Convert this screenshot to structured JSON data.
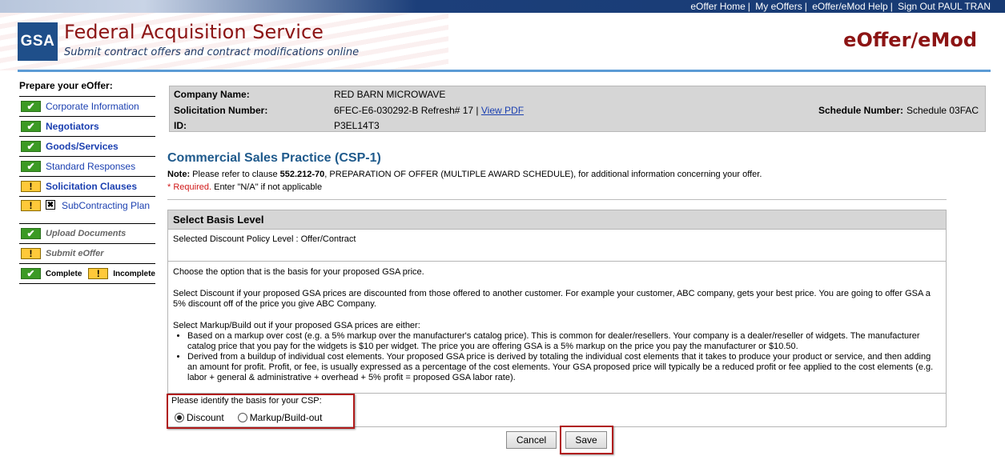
{
  "topbar": {
    "links": [
      "eOffer Home",
      "My eOffers",
      "eOffer/eMod Help",
      "Sign Out PAUL TRAN"
    ]
  },
  "header": {
    "logo_text": "GSA",
    "title": "Federal Acquisition Service",
    "subtitle": "Submit contract offers and contract modifications online",
    "brand": "eOffer/eMod"
  },
  "sidebar": {
    "heading": "Prepare your eOffer:",
    "items": [
      {
        "label": "Corporate Information",
        "status": "complete"
      },
      {
        "label": "Negotiators",
        "status": "complete"
      },
      {
        "label": "Goods/Services",
        "status": "complete"
      },
      {
        "label": "Standard Responses",
        "status": "complete"
      },
      {
        "label": "Solicitation Clauses",
        "status": "incomplete"
      },
      {
        "label": "SubContracting Plan",
        "status": "incomplete"
      },
      {
        "label": "Upload Documents",
        "status": "complete"
      },
      {
        "label": "Submit eOffer",
        "status": "incomplete"
      }
    ],
    "legend_complete": "Complete",
    "legend_incomplete": "Incomplete",
    "check_glyph": "✔",
    "warn_glyph": "!",
    "x_glyph": "✖"
  },
  "company": {
    "name_label": "Company Name:",
    "name_value": "RED BARN MICROWAVE",
    "solicitation_label": "Solicitation Number:",
    "solicitation_value": "6FEC-E6-030292-B Refresh# 17 |",
    "view_pdf": "View PDF",
    "id_label": "ID:",
    "id_value": "P3EL14T3",
    "schedule_label": "Schedule Number:",
    "schedule_value": "Schedule 03FAC"
  },
  "main": {
    "title": "Commercial Sales Practice (CSP-1)",
    "note_prefix": "Note:",
    "note_text_1": " Please refer to clause ",
    "note_clause": "552.212-70",
    "note_text_2": ", PREPARATION OF OFFER (MULTIPLE AWARD SCHEDULE), for additional information concerning your offer.",
    "required": "* Required.",
    "na_text": " Enter \"N/A\" if not applicable",
    "panel_title": "Select Basis Level",
    "policy_level": "Selected Discount Policy Level : Offer/Contract",
    "para1": "Choose the option that is the basis for your proposed GSA price.",
    "para2": "Select Discount if your proposed GSA prices are discounted from those offered to another customer. For example your customer, ABC company, gets your best price. You are going to offer GSA a 5% discount off of the price you give ABC Company.",
    "para3": "Select Markup/Build out if your proposed GSA prices are either:",
    "bullet1": "Based on a markup over cost (e.g. a 5% markup over the manufacturer's catalog price). This is common for dealer/resellers. Your company is a dealer/reseller of widgets. The manufacturer catalog price that you pay for the widgets is $10 per widget. The price you are offering GSA is a 5% markup on the price you pay the manufacturer or $10.50.",
    "bullet2": "Derived from a buildup of individual cost elements. Your proposed GSA price is derived by totaling the individual cost elements that it takes to produce your product or service, and then adding an amount for profit. Profit, or fee, is usually expressed as a percentage of the cost elements. Your GSA proposed price will typically be a reduced profit or fee applied to the cost elements (e.g. labor + general & administrative + overhead + 5% profit = proposed GSA labor rate).",
    "basis_question": "Please identify the basis for your CSP:",
    "option_discount": "Discount",
    "option_markup": "Markup/Build-out",
    "selected": "Discount",
    "cancel": "Cancel",
    "save": "Save"
  }
}
